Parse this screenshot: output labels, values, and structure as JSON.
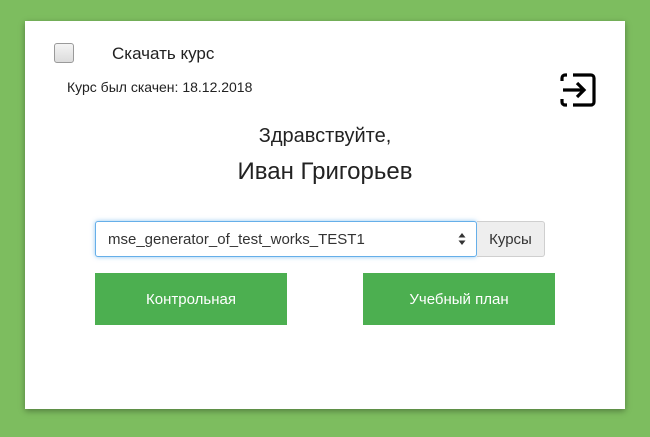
{
  "download": {
    "checkbox_label": "Скачать курс",
    "status_text": "Курс был скачен: 18.12.2018"
  },
  "logout": {
    "icon": "logout-icon"
  },
  "welcome": {
    "greeting": "Здравствуйте,",
    "user_name": "Иван Григорьев"
  },
  "course_select": {
    "selected_value": "mse_generator_of_test_works_TEST1",
    "courses_button_label": "Курсы"
  },
  "actions": {
    "test_button_label": "Контрольная",
    "study_plan_button_label": "Учебный план"
  },
  "colors": {
    "background": "#7dbd5f",
    "primary_green": "#4caf50",
    "focus_blue": "#66afe9"
  }
}
